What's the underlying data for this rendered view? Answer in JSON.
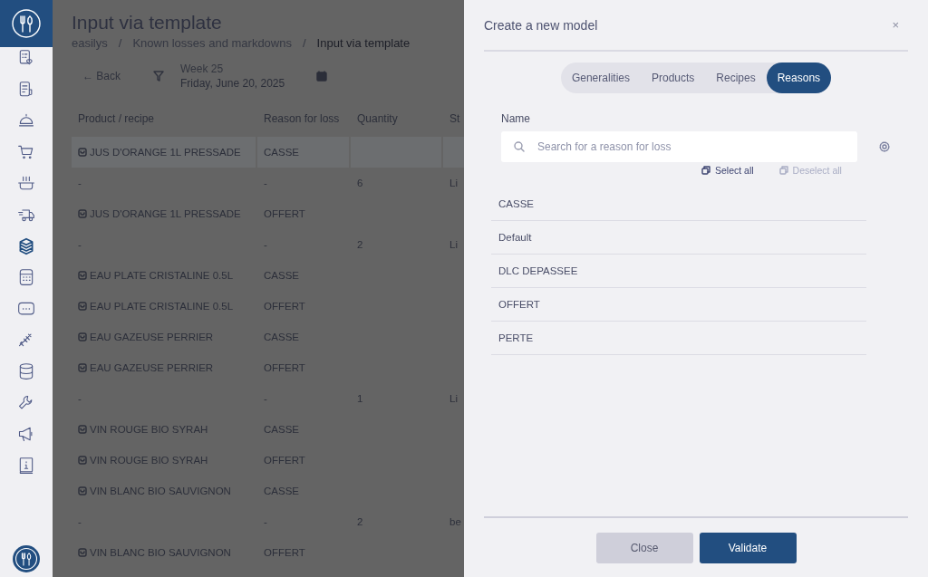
{
  "sidebar": {
    "items": [
      {
        "selected": false
      },
      {
        "selected": false
      },
      {
        "selected": false
      },
      {
        "selected": false
      },
      {
        "selected": false
      },
      {
        "selected": false
      },
      {
        "selected": true
      },
      {
        "selected": false
      },
      {
        "selected": false
      },
      {
        "selected": false
      },
      {
        "selected": false
      },
      {
        "selected": false
      },
      {
        "selected": false
      },
      {
        "selected": false
      }
    ]
  },
  "page": {
    "title": "Input via template",
    "breadcrumb": [
      {
        "kind": "link",
        "label": "easilys",
        "current": false
      },
      {
        "kind": "separator",
        "label": "/"
      },
      {
        "kind": "link",
        "label": "Known losses and markdowns",
        "current": false
      },
      {
        "kind": "separator",
        "label": "/"
      },
      {
        "kind": "link",
        "label": "Input via template",
        "current": true
      }
    ],
    "toolbar": {
      "back": "← Back",
      "week": "Week 25",
      "date": "Friday, June 20, 2025"
    }
  },
  "table": {
    "columns": [
      "Product / recipe",
      "Reason for loss",
      "Quantity",
      "St"
    ],
    "rows": [
      {
        "kind": "product",
        "selected": true,
        "cells": [
          "JUS D'ORANGE 1L PRESSADE",
          "CASSE",
          "",
          ""
        ]
      },
      {
        "kind": "detail",
        "selected": false,
        "cells": [
          "-",
          "-",
          "6",
          "Li"
        ]
      },
      {
        "kind": "product",
        "selected": false,
        "cells": [
          "JUS D'ORANGE 1L PRESSADE",
          "OFFERT",
          "",
          ""
        ]
      },
      {
        "kind": "detail",
        "selected": false,
        "cells": [
          "-",
          "-",
          "2",
          "Li"
        ]
      },
      {
        "kind": "product",
        "selected": false,
        "cells": [
          "EAU PLATE CRISTALINE 0.5L",
          "CASSE",
          "",
          ""
        ]
      },
      {
        "kind": "product",
        "selected": false,
        "cells": [
          "EAU PLATE CRISTALINE 0.5L",
          "OFFERT",
          "",
          ""
        ]
      },
      {
        "kind": "product",
        "selected": false,
        "cells": [
          "EAU GAZEUSE PERRIER",
          "CASSE",
          "",
          ""
        ]
      },
      {
        "kind": "product",
        "selected": false,
        "cells": [
          "EAU GAZEUSE PERRIER",
          "OFFERT",
          "",
          ""
        ]
      },
      {
        "kind": "detail",
        "selected": false,
        "cells": [
          "-",
          "-",
          "1",
          "Li"
        ]
      },
      {
        "kind": "product",
        "selected": false,
        "cells": [
          "VIN ROUGE BIO SYRAH",
          "CASSE",
          "",
          ""
        ]
      },
      {
        "kind": "product",
        "selected": false,
        "cells": [
          "VIN ROUGE BIO SYRAH",
          "OFFERT",
          "",
          ""
        ]
      },
      {
        "kind": "product",
        "selected": false,
        "cells": [
          "VIN BLANC BIO SAUVIGNON",
          "CASSE",
          "",
          ""
        ]
      },
      {
        "kind": "detail",
        "selected": false,
        "cells": [
          "-",
          "-",
          "2",
          "be"
        ]
      },
      {
        "kind": "product",
        "selected": false,
        "cells": [
          "VIN BLANC BIO SAUVIGNON",
          "OFFERT",
          "",
          ""
        ]
      }
    ]
  },
  "modal": {
    "title": "Create a new model",
    "close": "×",
    "tabs": [
      {
        "label": "Generalities",
        "selected": false
      },
      {
        "label": "Products",
        "selected": false
      },
      {
        "label": "Recipes",
        "selected": false
      },
      {
        "label": "Reasons",
        "selected": true
      }
    ],
    "name_label": "Name",
    "search": {
      "placeholder": "Search for a reason for loss"
    },
    "select_all": {
      "label": "Select all",
      "disabled": false
    },
    "deselect_all": {
      "label": "Deselect all",
      "disabled": true
    },
    "reasons": [
      "CASSE",
      "Default",
      "DLC DEPASSEE",
      "OFFERT",
      "PERTE"
    ],
    "buttons": [
      {
        "label": "Close",
        "kind": "secondary"
      },
      {
        "label": "Validate",
        "kind": "primary"
      }
    ]
  }
}
